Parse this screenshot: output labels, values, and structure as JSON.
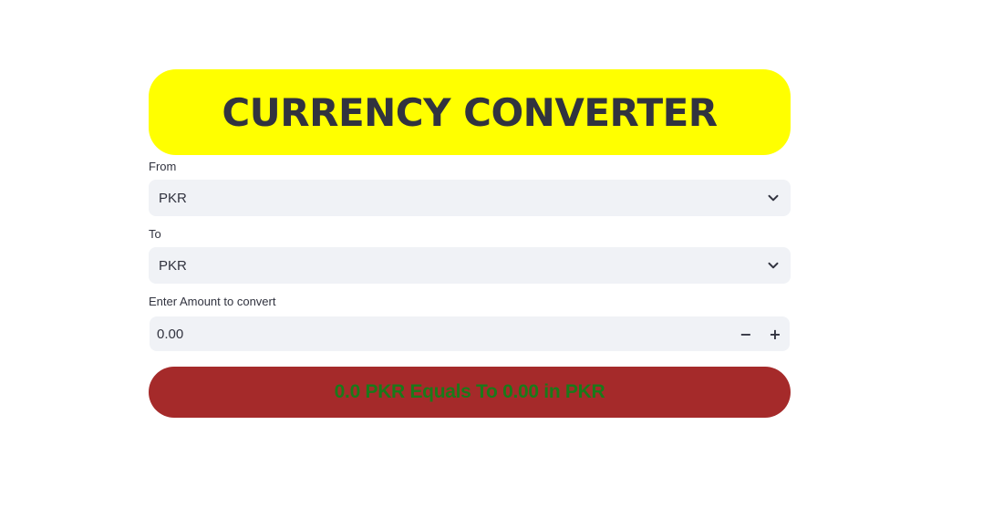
{
  "header": {
    "title": "CURRENCY CONVERTER",
    "bg_color": "#ffff00"
  },
  "from": {
    "label": "From",
    "selected": "PKR",
    "icon": "chevron-down-icon"
  },
  "to": {
    "label": "To",
    "selected": "PKR",
    "icon": "chevron-down-icon"
  },
  "amount": {
    "label": "Enter Amount to convert",
    "value": "0.00",
    "decrement_label": "−",
    "increment_label": "+"
  },
  "result": {
    "text": "0.0 PKR Equals To 0.00 in PKR",
    "bg_color": "#a52a2a",
    "text_color": "#1a7a1a"
  }
}
